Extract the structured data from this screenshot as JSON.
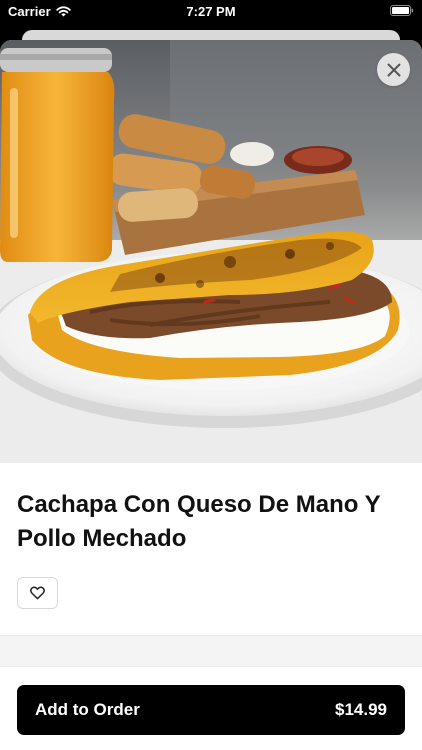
{
  "status_bar": {
    "carrier": "Carrier",
    "time": "7:27 PM",
    "icons": [
      "wifi-icon",
      "battery-icon"
    ]
  },
  "item": {
    "title": "Cachapa Con Queso De Mano Y Pollo Mechado",
    "image": "food-photo"
  },
  "actions": {
    "close_icon": "close-icon",
    "favorite_icon": "heart-icon"
  },
  "order": {
    "label": "Add to Order",
    "price": "$14.99"
  },
  "colors": {
    "button_bg": "#000000",
    "button_text": "#ffffff",
    "title_text": "#111111",
    "divider": "#f4f4f4"
  }
}
